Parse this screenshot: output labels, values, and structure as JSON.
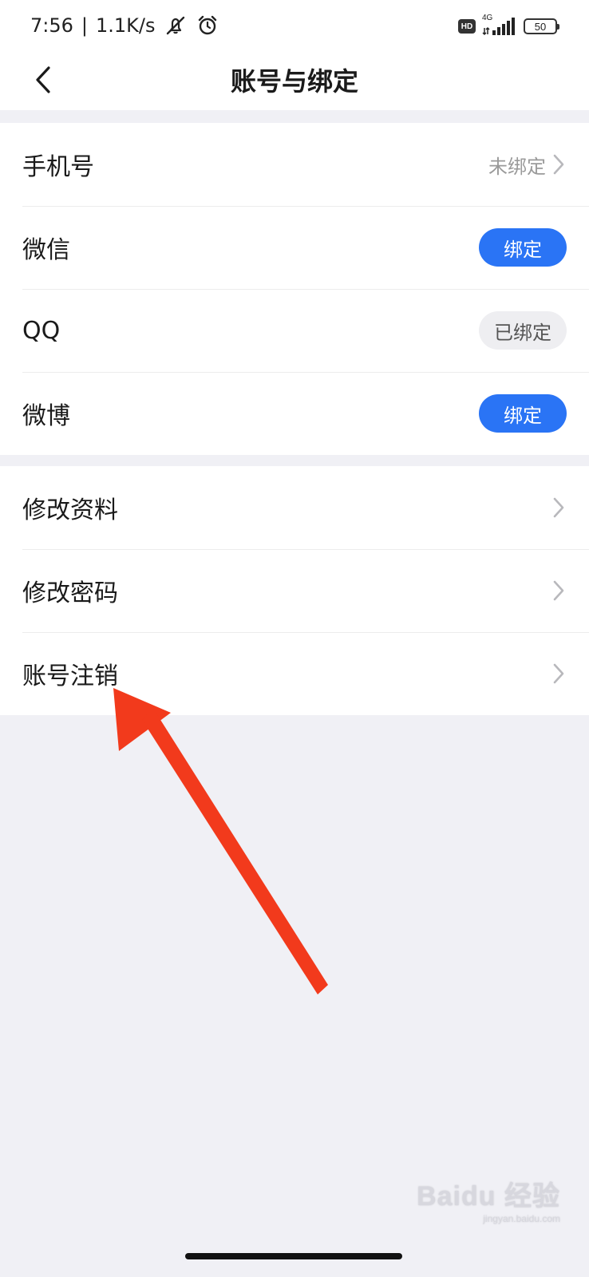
{
  "status_bar": {
    "time": "7:56",
    "separator": "|",
    "network_speed": "1.1K/s",
    "hd_label": "HD",
    "network_type": "4G",
    "battery_level": "50",
    "icons": [
      "mute-icon",
      "alarm-icon",
      "signal-icon",
      "battery-icon"
    ]
  },
  "header": {
    "title": "账号与绑定",
    "back_icon": "chevron-left-icon"
  },
  "binding_group": {
    "items": [
      {
        "label": "手机号",
        "status": "未绑定",
        "type": "link"
      },
      {
        "label": "微信",
        "action": "绑定",
        "type": "bind-button"
      },
      {
        "label": "QQ",
        "status": "已绑定",
        "type": "bound-badge"
      },
      {
        "label": "微博",
        "action": "绑定",
        "type": "bind-button"
      }
    ]
  },
  "account_group": {
    "items": [
      {
        "label": "修改资料",
        "type": "link"
      },
      {
        "label": "修改密码",
        "type": "link"
      },
      {
        "label": "账号注销",
        "type": "link"
      }
    ]
  },
  "watermark": {
    "brand": "Baidu 经验",
    "url": "jingyan.baidu.com"
  },
  "colors": {
    "primary": "#2a74f5",
    "page_background": "#f0f0f5",
    "annotation_arrow": "#f23a1c",
    "muted_badge": "#eeeef1"
  }
}
